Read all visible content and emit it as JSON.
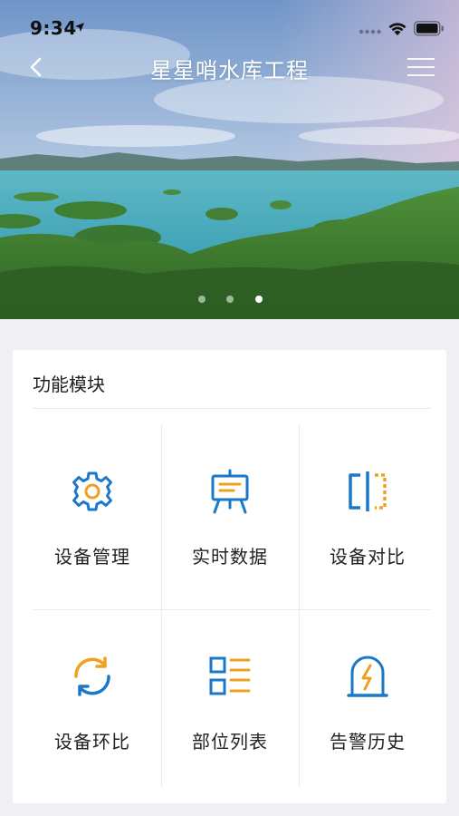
{
  "status_bar": {
    "time": "9:34"
  },
  "nav": {
    "title": "星星哨水库工程"
  },
  "carousel": {
    "slides": 3,
    "active_index": 2
  },
  "module": {
    "title": "功能模块",
    "items": [
      {
        "label": "设备管理",
        "icon": "gear-icon"
      },
      {
        "label": "实时数据",
        "icon": "presentation-board-icon"
      },
      {
        "label": "设备对比",
        "icon": "compare-icon"
      },
      {
        "label": "设备环比",
        "icon": "refresh-cycle-icon"
      },
      {
        "label": "部位列表",
        "icon": "list-icon"
      },
      {
        "label": "告警历史",
        "icon": "alarm-lightning-icon"
      }
    ]
  },
  "colors": {
    "icon_blue": "#1a78c8",
    "icon_orange": "#f0a020",
    "background": "#efeff4",
    "card": "#ffffff"
  }
}
